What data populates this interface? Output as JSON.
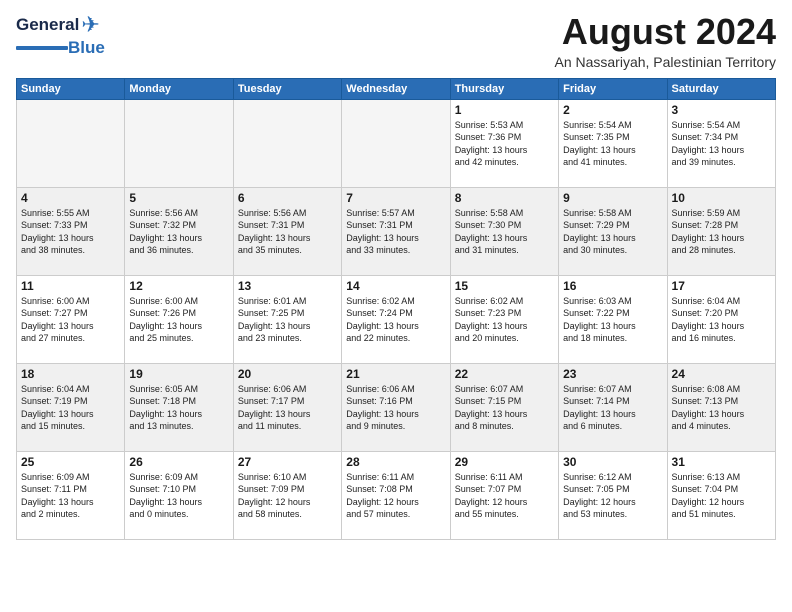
{
  "logo": {
    "text1": "General",
    "text2": "Blue"
  },
  "header": {
    "title": "August 2024",
    "subtitle": "An Nassariyah, Palestinian Territory"
  },
  "days_of_week": [
    "Sunday",
    "Monday",
    "Tuesday",
    "Wednesday",
    "Thursday",
    "Friday",
    "Saturday"
  ],
  "weeks": [
    [
      {
        "day": "",
        "info": ""
      },
      {
        "day": "",
        "info": ""
      },
      {
        "day": "",
        "info": ""
      },
      {
        "day": "",
        "info": ""
      },
      {
        "day": "1",
        "info": "Sunrise: 5:53 AM\nSunset: 7:36 PM\nDaylight: 13 hours\nand 42 minutes."
      },
      {
        "day": "2",
        "info": "Sunrise: 5:54 AM\nSunset: 7:35 PM\nDaylight: 13 hours\nand 41 minutes."
      },
      {
        "day": "3",
        "info": "Sunrise: 5:54 AM\nSunset: 7:34 PM\nDaylight: 13 hours\nand 39 minutes."
      }
    ],
    [
      {
        "day": "4",
        "info": "Sunrise: 5:55 AM\nSunset: 7:33 PM\nDaylight: 13 hours\nand 38 minutes."
      },
      {
        "day": "5",
        "info": "Sunrise: 5:56 AM\nSunset: 7:32 PM\nDaylight: 13 hours\nand 36 minutes."
      },
      {
        "day": "6",
        "info": "Sunrise: 5:56 AM\nSunset: 7:31 PM\nDaylight: 13 hours\nand 35 minutes."
      },
      {
        "day": "7",
        "info": "Sunrise: 5:57 AM\nSunset: 7:31 PM\nDaylight: 13 hours\nand 33 minutes."
      },
      {
        "day": "8",
        "info": "Sunrise: 5:58 AM\nSunset: 7:30 PM\nDaylight: 13 hours\nand 31 minutes."
      },
      {
        "day": "9",
        "info": "Sunrise: 5:58 AM\nSunset: 7:29 PM\nDaylight: 13 hours\nand 30 minutes."
      },
      {
        "day": "10",
        "info": "Sunrise: 5:59 AM\nSunset: 7:28 PM\nDaylight: 13 hours\nand 28 minutes."
      }
    ],
    [
      {
        "day": "11",
        "info": "Sunrise: 6:00 AM\nSunset: 7:27 PM\nDaylight: 13 hours\nand 27 minutes."
      },
      {
        "day": "12",
        "info": "Sunrise: 6:00 AM\nSunset: 7:26 PM\nDaylight: 13 hours\nand 25 minutes."
      },
      {
        "day": "13",
        "info": "Sunrise: 6:01 AM\nSunset: 7:25 PM\nDaylight: 13 hours\nand 23 minutes."
      },
      {
        "day": "14",
        "info": "Sunrise: 6:02 AM\nSunset: 7:24 PM\nDaylight: 13 hours\nand 22 minutes."
      },
      {
        "day": "15",
        "info": "Sunrise: 6:02 AM\nSunset: 7:23 PM\nDaylight: 13 hours\nand 20 minutes."
      },
      {
        "day": "16",
        "info": "Sunrise: 6:03 AM\nSunset: 7:22 PM\nDaylight: 13 hours\nand 18 minutes."
      },
      {
        "day": "17",
        "info": "Sunrise: 6:04 AM\nSunset: 7:20 PM\nDaylight: 13 hours\nand 16 minutes."
      }
    ],
    [
      {
        "day": "18",
        "info": "Sunrise: 6:04 AM\nSunset: 7:19 PM\nDaylight: 13 hours\nand 15 minutes."
      },
      {
        "day": "19",
        "info": "Sunrise: 6:05 AM\nSunset: 7:18 PM\nDaylight: 13 hours\nand 13 minutes."
      },
      {
        "day": "20",
        "info": "Sunrise: 6:06 AM\nSunset: 7:17 PM\nDaylight: 13 hours\nand 11 minutes."
      },
      {
        "day": "21",
        "info": "Sunrise: 6:06 AM\nSunset: 7:16 PM\nDaylight: 13 hours\nand 9 minutes."
      },
      {
        "day": "22",
        "info": "Sunrise: 6:07 AM\nSunset: 7:15 PM\nDaylight: 13 hours\nand 8 minutes."
      },
      {
        "day": "23",
        "info": "Sunrise: 6:07 AM\nSunset: 7:14 PM\nDaylight: 13 hours\nand 6 minutes."
      },
      {
        "day": "24",
        "info": "Sunrise: 6:08 AM\nSunset: 7:13 PM\nDaylight: 13 hours\nand 4 minutes."
      }
    ],
    [
      {
        "day": "25",
        "info": "Sunrise: 6:09 AM\nSunset: 7:11 PM\nDaylight: 13 hours\nand 2 minutes."
      },
      {
        "day": "26",
        "info": "Sunrise: 6:09 AM\nSunset: 7:10 PM\nDaylight: 13 hours\nand 0 minutes."
      },
      {
        "day": "27",
        "info": "Sunrise: 6:10 AM\nSunset: 7:09 PM\nDaylight: 12 hours\nand 58 minutes."
      },
      {
        "day": "28",
        "info": "Sunrise: 6:11 AM\nSunset: 7:08 PM\nDaylight: 12 hours\nand 57 minutes."
      },
      {
        "day": "29",
        "info": "Sunrise: 6:11 AM\nSunset: 7:07 PM\nDaylight: 12 hours\nand 55 minutes."
      },
      {
        "day": "30",
        "info": "Sunrise: 6:12 AM\nSunset: 7:05 PM\nDaylight: 12 hours\nand 53 minutes."
      },
      {
        "day": "31",
        "info": "Sunrise: 6:13 AM\nSunset: 7:04 PM\nDaylight: 12 hours\nand 51 minutes."
      }
    ]
  ]
}
